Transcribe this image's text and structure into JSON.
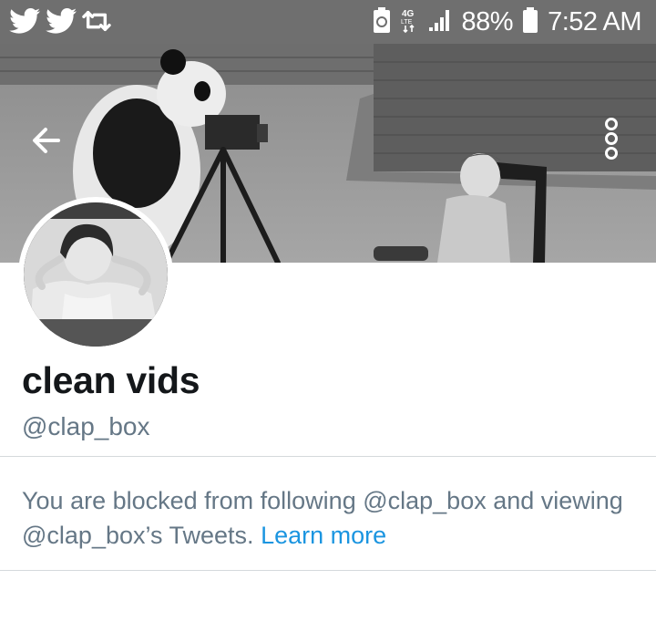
{
  "status_bar": {
    "left_icons": [
      "twitter-icon",
      "twitter-icon",
      "retweet-icon"
    ],
    "right_icons": [
      "battery-saver-icon",
      "network-4g-lte-icon",
      "signal-icon",
      "battery-icon"
    ],
    "battery_percent": "88%",
    "time": "7:52 AM"
  },
  "header": {
    "back_icon": "back-arrow-icon",
    "more_icon": "more-vertical-icon"
  },
  "profile": {
    "display_name": "clean vids",
    "handle": "@clap_box"
  },
  "blocked_notice": {
    "text": "You are blocked from following @clap_box and viewing @clap_box’s Tweets.",
    "link_label": "Learn more"
  },
  "colors": {
    "status_bar_bg": "#6f6f6f",
    "name": "#14171a",
    "muted": "#657786",
    "link": "#1b95e0",
    "divider": "#d5d9dc"
  }
}
